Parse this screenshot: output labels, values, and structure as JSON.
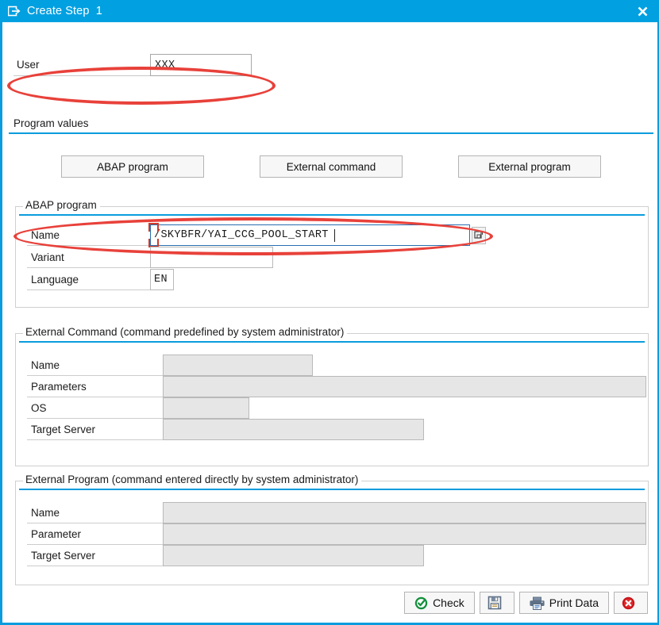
{
  "window": {
    "title": "Create Step  1",
    "title_icon": "step-arrow-icon",
    "close_icon": "close-icon",
    "accent_color": "#00a0e1",
    "annotation_color": "#e8413a"
  },
  "user_row": {
    "label": "User",
    "value": "XXX"
  },
  "program_values": {
    "title": "Program values",
    "buttons": [
      {
        "name": "abap-program",
        "label": "ABAP program"
      },
      {
        "name": "external-command",
        "label": "External command"
      },
      {
        "name": "external-program",
        "label": "External program"
      }
    ]
  },
  "abap_program": {
    "title": "ABAP program",
    "fields": [
      {
        "name": "name",
        "label": "Name",
        "value": "/SKYBFR/YAI_CCG_POOL_START",
        "state": "focused"
      },
      {
        "name": "variant",
        "label": "Variant",
        "value": "",
        "state": "editable"
      },
      {
        "name": "language",
        "label": "Language",
        "value": "EN",
        "state": "editable"
      }
    ],
    "value_help_icon": "value-help-icon"
  },
  "external_command": {
    "title": "External Command (command predefined by system administrator)",
    "fields": [
      {
        "name": "name",
        "label": "Name",
        "value": "",
        "state": "disabled"
      },
      {
        "name": "parameters",
        "label": "Parameters",
        "value": "",
        "state": "disabled"
      },
      {
        "name": "os",
        "label": "OS",
        "value": "",
        "state": "disabled"
      },
      {
        "name": "target-server",
        "label": "Target Server",
        "value": "",
        "state": "disabled"
      }
    ]
  },
  "external_program": {
    "title": "External Program (command entered directly by system administrator)",
    "fields": [
      {
        "name": "name",
        "label": "Name",
        "value": "",
        "state": "disabled"
      },
      {
        "name": "parameter",
        "label": "Parameter",
        "value": "",
        "state": "disabled"
      },
      {
        "name": "target-server",
        "label": "Target Server",
        "value": "",
        "state": "disabled"
      }
    ]
  },
  "toolbar": {
    "check_label": "Check",
    "check_icon": "check-circle-icon",
    "save_label": "",
    "save_icon": "save-floppy-icon",
    "print_label": "Print Data",
    "print_icon": "printer-icon",
    "cancel_label": "",
    "cancel_icon": "cancel-circle-icon"
  }
}
